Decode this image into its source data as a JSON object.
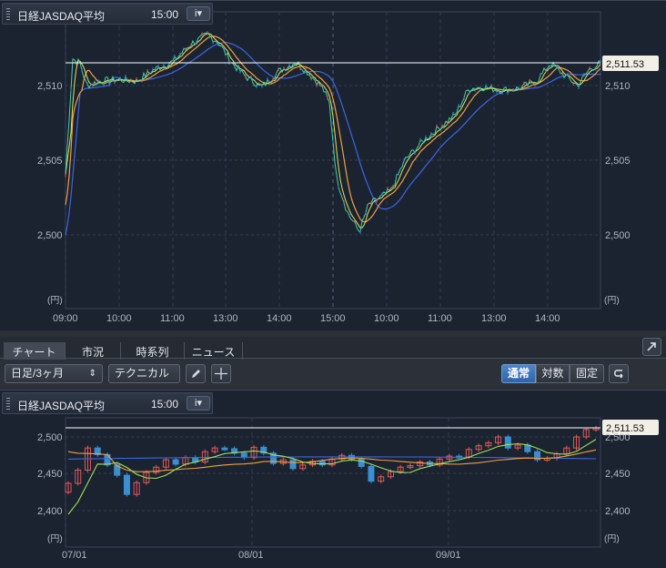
{
  "top_chart": {
    "title": "日経JASDAQ平均",
    "time": "15:00",
    "info_icon": "i▾",
    "price_tag": "2,511.53",
    "y_unit": "(円)",
    "y_ticks": [
      "2,510",
      "2,505",
      "2,500"
    ],
    "x_ticks": [
      "09:00",
      "10:00",
      "11:00",
      "13:00",
      "14:00",
      "15:00",
      "10:00",
      "11:00",
      "13:00",
      "14:00"
    ]
  },
  "tabs": {
    "chart": "チャート",
    "market": "市況",
    "timeseries": "時系列",
    "news": "ニュース"
  },
  "toolbar": {
    "period": "日足/3ヶ月",
    "technical": "テクニカル",
    "mode_normal": "通常",
    "mode_log": "対数",
    "mode_fixed": "固定"
  },
  "bottom_chart": {
    "title": "日経JASDAQ平均",
    "time": "15:00",
    "info_icon": "i▾",
    "price_tag": "2,511.53",
    "y_unit": "(円)",
    "y_ticks": [
      "2,500",
      "2,450",
      "2,400"
    ],
    "x_ticks": [
      "07/01",
      "08/01",
      "09/01"
    ]
  },
  "colors": {
    "bg": "#1b2331",
    "price": "#3fd3a8",
    "ma1": "#e0e35a",
    "ma2": "#f0a040",
    "ma3": "#3d67e0",
    "up": "#e05a5a",
    "down": "#3b8fd0"
  }
}
